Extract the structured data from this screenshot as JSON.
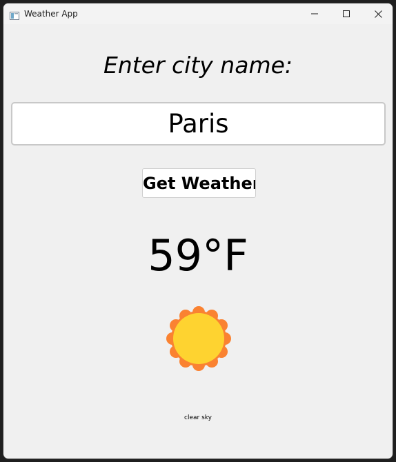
{
  "window": {
    "title": "Weather App"
  },
  "prompt": {
    "label": "Enter city name:"
  },
  "city_input": {
    "value": "Paris",
    "placeholder": ""
  },
  "actions": {
    "get_weather_label": "Get Weather"
  },
  "weather": {
    "temperature": "59°F",
    "description": "clear sky",
    "icon": "sun-icon"
  },
  "colors": {
    "sun_outer": "#fa8231",
    "sun_inner": "#fed330",
    "window_bg": "#f0f0f0"
  }
}
